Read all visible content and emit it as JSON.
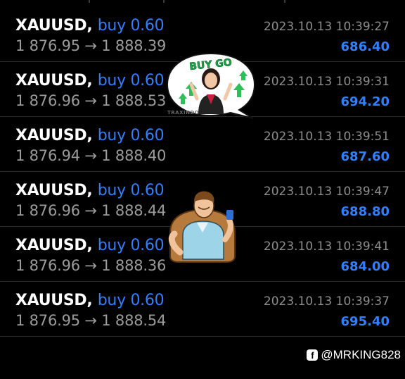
{
  "trades": [
    {
      "symbol": "XAUUSD,",
      "side": "buy 0.60",
      "open_price": "1 876.95",
      "close_price": "1 888.39",
      "time": "2023.10.13 10:39:27",
      "profit": "686.40"
    },
    {
      "symbol": "XAUUSD,",
      "side": "buy 0.60",
      "open_price": "1 876.96",
      "close_price": "1 888.53",
      "time": "2023.10.13 10:39:31",
      "profit": "694.20"
    },
    {
      "symbol": "XAUUSD,",
      "side": "buy 0.60",
      "open_price": "1 876.94",
      "close_price": "1 888.40",
      "time": "2023.10.13 10:39:51",
      "profit": "687.60"
    },
    {
      "symbol": "XAUUSD,",
      "side": "buy 0.60",
      "open_price": "1 876.96",
      "close_price": "1 888.44",
      "time": "2023.10.13 10:39:47",
      "profit": "688.80"
    },
    {
      "symbol": "XAUUSD,",
      "side": "buy 0.60",
      "open_price": "1 876.96",
      "close_price": "1 888.36",
      "time": "2023.10.13 10:39:41",
      "profit": "684.00"
    },
    {
      "symbol": "XAUUSD,",
      "side": "buy 0.60",
      "open_price": "1 876.95",
      "close_price": "1 888.54",
      "time": "2023.10.13 10:39:37",
      "profit": "695.40"
    }
  ],
  "price_arrow": "→",
  "sticker_buy": {
    "text": "BUY GO",
    "brand": "TRAXINDO"
  },
  "watermark": {
    "fb_glyph": "f",
    "handle": "@MRKING828"
  },
  "colors": {
    "background": "#000000",
    "accent_blue": "#2f7fff",
    "price_gray": "#9b9b9b",
    "divider": "#2d2d2d"
  }
}
